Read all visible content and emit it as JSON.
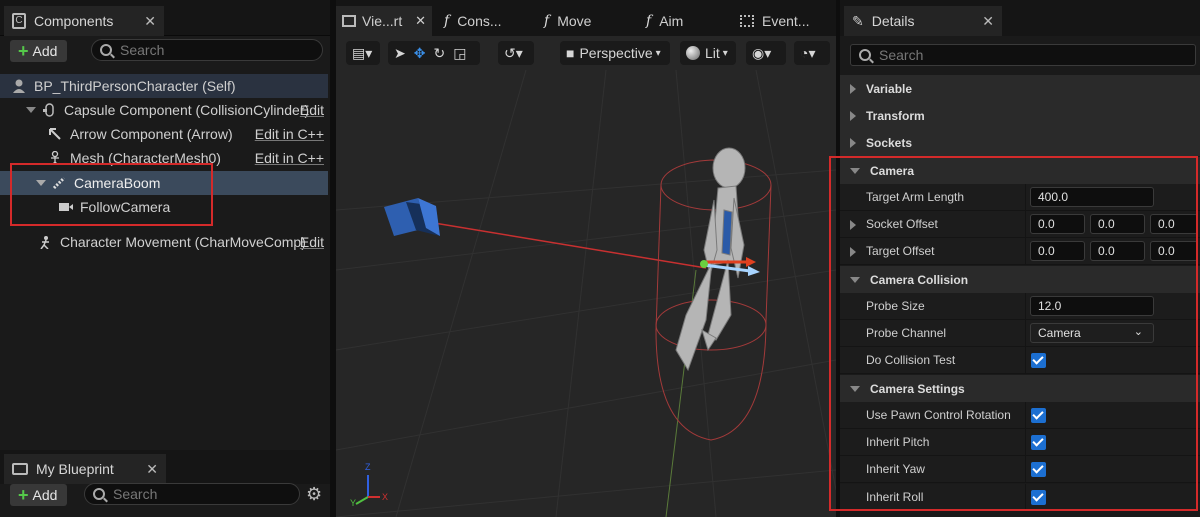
{
  "components_panel": {
    "tab_title": "Components",
    "add_label": "Add",
    "search_placeholder": "Search",
    "tree": [
      {
        "label": "BP_ThirdPersonCharacter (Self)",
        "edit": ""
      },
      {
        "label": "Capsule Component (CollisionCylinder)",
        "edit": "Edit"
      },
      {
        "label": "Arrow Component (Arrow)",
        "edit": "Edit in C++"
      },
      {
        "label": "Mesh (CharacterMesh0)",
        "edit": "Edit in C++"
      },
      {
        "label": "CameraBoom",
        "edit": ""
      },
      {
        "label": "FollowCamera",
        "edit": ""
      },
      {
        "label": "Character Movement (CharMoveComp)",
        "edit": "Edit"
      }
    ]
  },
  "my_blueprint": {
    "tab_title": "My Blueprint",
    "add_label": "Add",
    "search_placeholder": "Search"
  },
  "viewport": {
    "tabs": [
      "Vie...rt",
      "Cons...",
      "Move",
      "Aim",
      "Event..."
    ],
    "perspective_label": "Perspective",
    "lit_label": "Lit",
    "axis_z": "Z",
    "axis_y": "Y",
    "axis_x": "X"
  },
  "details": {
    "tab_title": "Details",
    "search_placeholder": "Search",
    "sections": {
      "variable": "Variable",
      "transform": "Transform",
      "sockets": "Sockets",
      "camera": "Camera",
      "camera_collision": "Camera Collision",
      "camera_settings": "Camera Settings"
    },
    "props": {
      "target_arm_length": {
        "label": "Target Arm Length",
        "value": "400.0"
      },
      "socket_offset": {
        "label": "Socket Offset",
        "x": "0.0",
        "y": "0.0",
        "z": "0.0"
      },
      "target_offset": {
        "label": "Target Offset",
        "x": "0.0",
        "y": "0.0",
        "z": "0.0"
      },
      "probe_size": {
        "label": "Probe Size",
        "value": "12.0"
      },
      "probe_channel": {
        "label": "Probe Channel",
        "value": "Camera"
      },
      "do_collision_test": {
        "label": "Do Collision Test",
        "checked": true
      },
      "use_pawn_control_rotation": {
        "label": "Use Pawn Control Rotation",
        "checked": true
      },
      "inherit_pitch": {
        "label": "Inherit Pitch",
        "checked": true
      },
      "inherit_yaw": {
        "label": "Inherit Yaw",
        "checked": true
      },
      "inherit_roll": {
        "label": "Inherit Roll",
        "checked": true
      }
    }
  },
  "colors": {
    "highlight_box": "#d42a2a",
    "selected_row": "#3b4a5c",
    "checkbox": "#1c6fd1",
    "add_plus": "#55c94a"
  }
}
